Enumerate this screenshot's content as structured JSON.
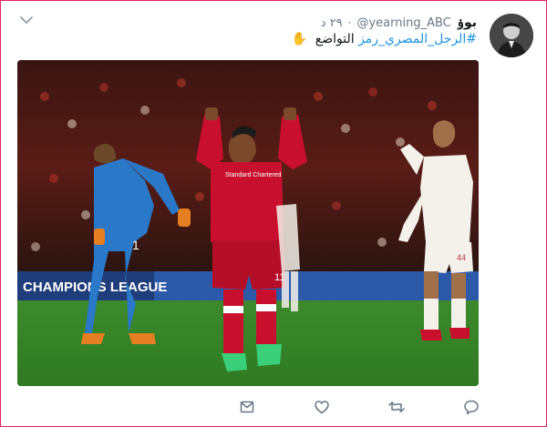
{
  "tweet": {
    "display_name": "بوۏ",
    "handle": "@yearning_ABC",
    "separator": "·",
    "time": "٢٩ د",
    "hashtag": "#الرجل_المصري_رمز",
    "text_after_hashtag": "التواضع",
    "emoji": "✋"
  },
  "media": {
    "ad_board_left": "CHAMPIONS LEAGUE",
    "shirt_sponsor": "Standard Chartered",
    "shirt_number_player": "11",
    "shirt_number_keeper": "1",
    "shirt_number_right": "44"
  },
  "actions": [
    {
      "name": "reply-icon"
    },
    {
      "name": "retweet-icon"
    },
    {
      "name": "like-icon"
    },
    {
      "name": "share-icon"
    }
  ],
  "colors": {
    "hashtag": "#1b95e0",
    "muted": "#657786",
    "frame": "#e0245e"
  }
}
